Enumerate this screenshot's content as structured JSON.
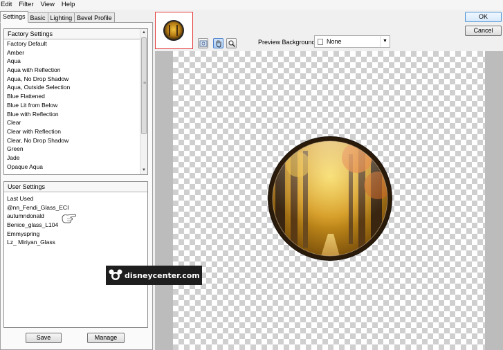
{
  "menu": [
    "Edit",
    "Filter",
    "View",
    "Help"
  ],
  "tabs": [
    "Settings",
    "Basic",
    "Lighting",
    "Bevel Profile"
  ],
  "factory_settings": {
    "header": "Factory Settings",
    "items": [
      "Factory Default",
      "Amber",
      "Aqua",
      "Aqua with Reflection",
      "Aqua, No Drop Shadow",
      "Aqua, Outside Selection",
      "Blue Flattened",
      "Blue Lit from Below",
      "Blue with Reflection",
      "Clear",
      "Clear with Reflection",
      "Clear, No Drop Shadow",
      "Green",
      "Jade",
      "Opaque Aqua"
    ]
  },
  "user_settings": {
    "header": "User Settings",
    "items": [
      "Last Used",
      "@nn_Fendi_Glass_ECI",
      "autumndonald",
      "Benice_glass_L104",
      "Emmyspring",
      "Lz_ Miriyan_Glass"
    ]
  },
  "buttons": {
    "save": "Save",
    "manage": "Manage",
    "ok": "OK",
    "cancel": "Cancel"
  },
  "preview_background": {
    "label": "Preview Background:",
    "value": "None"
  },
  "watermark": "disneycenter.com",
  "colors": {
    "ok_border": "#4a90d0",
    "thumb_border": "#e53c3c",
    "checker": "#cfcfcf"
  }
}
